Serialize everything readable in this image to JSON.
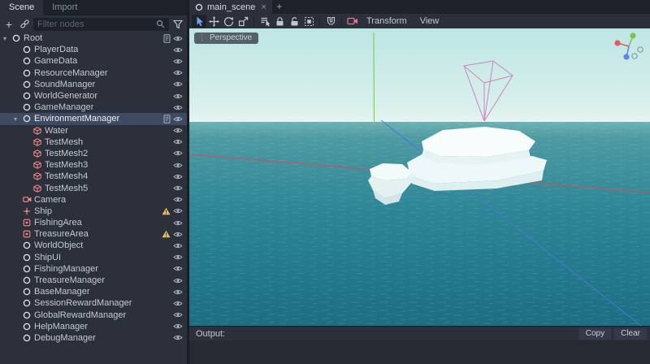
{
  "window": {
    "bg": "#21252e",
    "accent": "#6fa3ef"
  },
  "left_dock": {
    "tabs": [
      {
        "label": "Scene",
        "active": true
      },
      {
        "label": "Import",
        "active": false
      }
    ],
    "add_button": "+",
    "filter_placeholder": "Filter nodes",
    "tree": [
      {
        "label": "Root",
        "depth": 0,
        "icon": "node",
        "expander": true,
        "right": [
          "script",
          "eye"
        ]
      },
      {
        "label": "PlayerData",
        "depth": 1,
        "icon": "node",
        "right": [
          "eye"
        ]
      },
      {
        "label": "GameData",
        "depth": 1,
        "icon": "node",
        "right": [
          "eye"
        ]
      },
      {
        "label": "ResourceManager",
        "depth": 1,
        "icon": "node",
        "right": [
          "eye"
        ]
      },
      {
        "label": "SoundManager",
        "depth": 1,
        "icon": "node",
        "right": [
          "eye"
        ]
      },
      {
        "label": "WorldGenerator",
        "depth": 1,
        "icon": "node",
        "right": [
          "eye"
        ]
      },
      {
        "label": "GameManager",
        "depth": 1,
        "icon": "node",
        "right": [
          "eye"
        ]
      },
      {
        "label": "EnvironmentManager",
        "depth": 1,
        "icon": "node",
        "expander": true,
        "selected": true,
        "right": [
          "script",
          "eye"
        ]
      },
      {
        "label": "Water",
        "depth": 2,
        "icon": "mesh",
        "right": [
          "eye"
        ]
      },
      {
        "label": "TestMesh",
        "depth": 2,
        "icon": "mesh",
        "right": [
          "eye"
        ]
      },
      {
        "label": "TestMesh2",
        "depth": 2,
        "icon": "mesh",
        "right": [
          "eye"
        ]
      },
      {
        "label": "TestMesh3",
        "depth": 2,
        "icon": "mesh",
        "right": [
          "eye"
        ]
      },
      {
        "label": "TestMesh4",
        "depth": 2,
        "icon": "mesh",
        "right": [
          "eye"
        ]
      },
      {
        "label": "TestMesh5",
        "depth": 2,
        "icon": "mesh",
        "right": [
          "eye"
        ]
      },
      {
        "label": "Camera",
        "depth": 1,
        "icon": "camera",
        "right": [
          "eye"
        ]
      },
      {
        "label": "Ship",
        "depth": 1,
        "icon": "spatial",
        "right": [
          "warning",
          "eye"
        ]
      },
      {
        "label": "FishingArea",
        "depth": 1,
        "icon": "area",
        "right": [
          "eye"
        ]
      },
      {
        "label": "TreasureArea",
        "depth": 1,
        "icon": "area",
        "right": [
          "warning",
          "eye"
        ]
      },
      {
        "label": "WorldObject",
        "depth": 1,
        "icon": "node",
        "right": [
          "eye"
        ]
      },
      {
        "label": "ShipUI",
        "depth": 1,
        "icon": "node",
        "right": [
          "eye"
        ]
      },
      {
        "label": "FishingManager",
        "depth": 1,
        "icon": "node",
        "right": [
          "eye"
        ]
      },
      {
        "label": "TreasureManager",
        "depth": 1,
        "icon": "node",
        "right": [
          "eye"
        ]
      },
      {
        "label": "BaseManager",
        "depth": 1,
        "icon": "node",
        "right": [
          "eye"
        ]
      },
      {
        "label": "SessionRewardManager",
        "depth": 1,
        "icon": "node",
        "right": [
          "eye"
        ]
      },
      {
        "label": "GlobalRewardManager",
        "depth": 1,
        "icon": "node",
        "right": [
          "eye"
        ]
      },
      {
        "label": "HelpManager",
        "depth": 1,
        "icon": "node",
        "right": [
          "eye"
        ]
      },
      {
        "label": "DebugManager",
        "depth": 1,
        "icon": "node",
        "right": [
          "eye"
        ]
      }
    ]
  },
  "scene_tab_bar": {
    "tabs": [
      {
        "label": "main_scene",
        "active": true
      }
    ],
    "close_label": "×",
    "add_label": "+"
  },
  "viewport_toolbar": {
    "tools": [
      {
        "name": "select-tool",
        "active": true
      },
      {
        "name": "move-tool"
      },
      {
        "name": "rotate-tool"
      },
      {
        "name": "scale-tool"
      },
      {
        "name": "separator"
      },
      {
        "name": "list-select-tool"
      },
      {
        "name": "lock-tool"
      },
      {
        "name": "unlock-tool"
      },
      {
        "name": "group-tool"
      },
      {
        "name": "separator"
      },
      {
        "name": "snap-tool"
      },
      {
        "name": "separator"
      },
      {
        "name": "camera-preview-tool",
        "color": "#e07a93"
      }
    ],
    "menus": [
      "Transform",
      "View"
    ]
  },
  "viewport": {
    "projection_label": "Perspective"
  },
  "output_panel": {
    "title": "Output:",
    "copy_label": "Copy",
    "clear_label": "Clear"
  },
  "scene_colors": {
    "sky": "#bde6e4",
    "sea": "#2c8595",
    "axis_x": "#d84b55",
    "axis_y": "#7fd14f",
    "axis_z": "#4f74d8",
    "gizmo_magenta": "#cf6fb8",
    "iceberg": "#f7fcfc"
  }
}
